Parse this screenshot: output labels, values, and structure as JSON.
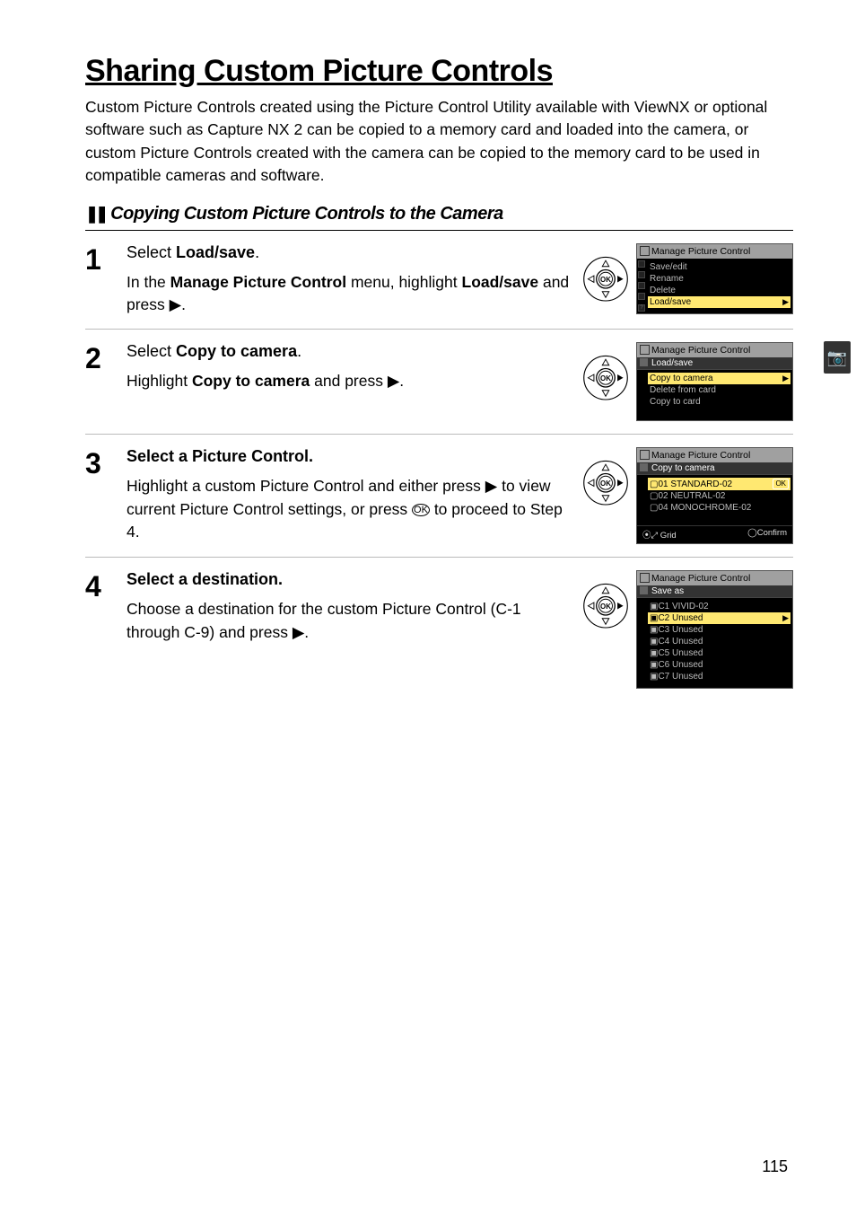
{
  "page": {
    "title": "Sharing Custom Picture Controls",
    "intro": "Custom Picture Controls created using the Picture Control Utility available with ViewNX or optional software such as Capture NX 2 can be copied to a memory card and loaded into the camera, or custom Picture Controls created with the camera can be copied to the memory card to be used in compatible cameras and software.",
    "number": "115"
  },
  "subhead": {
    "marker": "❚❚",
    "title": "Copying Custom Picture Controls to the Camera"
  },
  "sidetab": {
    "icon": "📷"
  },
  "glyphs": {
    "right_tri": "▶",
    "ok_circle": "OK"
  },
  "steps": [
    {
      "num": "1",
      "head_lead": "Select ",
      "head_bold": "Load/save",
      "head_tail": ".",
      "text_parts": [
        "In the ",
        "Manage Picture Control",
        " menu, highlight ",
        "Load/save",
        " and press ▶."
      ],
      "screen": {
        "title": "Manage Picture Control",
        "crumb": "",
        "rows": [
          {
            "label": "Save/edit",
            "hl": false
          },
          {
            "label": "Rename",
            "hl": false
          },
          {
            "label": "Delete",
            "hl": false
          },
          {
            "label": "Load/save",
            "hl": true,
            "arrow": "▶"
          }
        ],
        "foot": null
      }
    },
    {
      "num": "2",
      "head_lead": "Select ",
      "head_bold": "Copy to camera",
      "head_tail": ".",
      "text_parts": [
        "Highlight ",
        "Copy to camera",
        " and press ▶."
      ],
      "screen": {
        "title": "Manage Picture Control",
        "crumb": "Load/save",
        "rows": [
          {
            "label": "Copy to camera",
            "hl": true,
            "arrow": "▶"
          },
          {
            "label": "Delete from card",
            "hl": false
          },
          {
            "label": "Copy to card",
            "hl": false
          }
        ],
        "foot": null
      }
    },
    {
      "num": "3",
      "head_lead": "Select a Picture Control.",
      "head_bold": "",
      "head_tail": "",
      "text_parts": [
        "Highlight a custom Picture Control and either press ▶ to view current Picture Control settings, or press ",
        "OK",
        " to proceed to Step 4."
      ],
      "screen": {
        "title": "Manage Picture Control",
        "crumb": "Copy to camera",
        "rows": [
          {
            "label": "▢01 STANDARD-02",
            "hl": true,
            "ok": "OK"
          },
          {
            "label": "▢02 NEUTRAL-02",
            "hl": false
          },
          {
            "label": "▢04 MONOCHROME-02",
            "hl": false
          }
        ],
        "foot": {
          "left": "⦿⤢ Grid",
          "right": "◯Confirm"
        }
      }
    },
    {
      "num": "4",
      "head_lead": "Select a destination.",
      "head_bold": "",
      "head_tail": "",
      "text_parts": [
        "Choose a destination for the custom Picture Control (C-1 through C-9) and press ▶."
      ],
      "screen": {
        "title": "Manage Picture Control",
        "crumb": "Save as",
        "rows": [
          {
            "label": "▣C1 VIVID-02",
            "hl": false
          },
          {
            "label": "▣C2 Unused",
            "hl": true,
            "arrow": "▶"
          },
          {
            "label": "▣C3 Unused",
            "hl": false
          },
          {
            "label": "▣C4 Unused",
            "hl": false
          },
          {
            "label": "▣C5 Unused",
            "hl": false
          },
          {
            "label": "▣C6 Unused",
            "hl": false
          },
          {
            "label": "▣C7 Unused",
            "hl": false
          }
        ],
        "foot": null
      }
    }
  ]
}
